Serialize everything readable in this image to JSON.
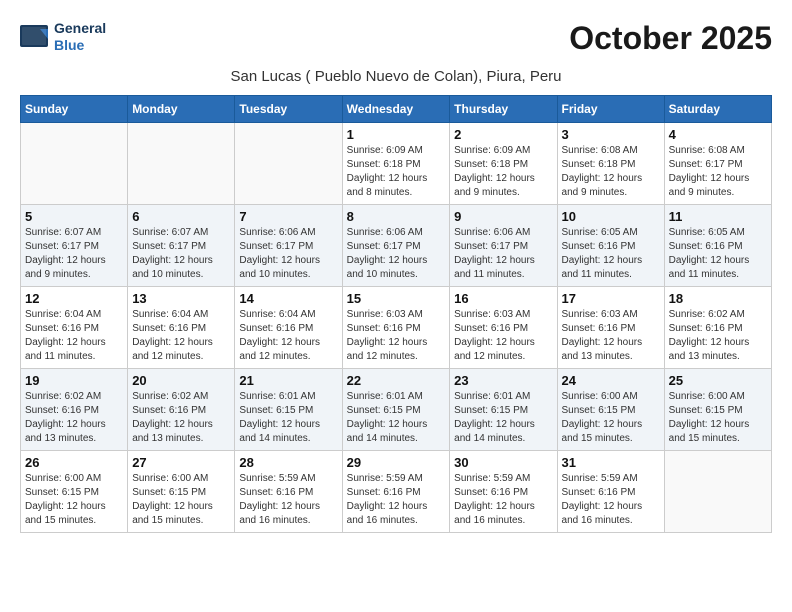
{
  "logo": {
    "line1": "General",
    "line2": "Blue"
  },
  "header": {
    "title": "October 2025",
    "subtitle": "San Lucas ( Pueblo Nuevo de Colan), Piura, Peru"
  },
  "weekdays": [
    "Sunday",
    "Monday",
    "Tuesday",
    "Wednesday",
    "Thursday",
    "Friday",
    "Saturday"
  ],
  "weeks": [
    [
      {
        "day": "",
        "info": ""
      },
      {
        "day": "",
        "info": ""
      },
      {
        "day": "",
        "info": ""
      },
      {
        "day": "1",
        "info": "Sunrise: 6:09 AM\nSunset: 6:18 PM\nDaylight: 12 hours and 8 minutes."
      },
      {
        "day": "2",
        "info": "Sunrise: 6:09 AM\nSunset: 6:18 PM\nDaylight: 12 hours and 9 minutes."
      },
      {
        "day": "3",
        "info": "Sunrise: 6:08 AM\nSunset: 6:18 PM\nDaylight: 12 hours and 9 minutes."
      },
      {
        "day": "4",
        "info": "Sunrise: 6:08 AM\nSunset: 6:17 PM\nDaylight: 12 hours and 9 minutes."
      }
    ],
    [
      {
        "day": "5",
        "info": "Sunrise: 6:07 AM\nSunset: 6:17 PM\nDaylight: 12 hours and 9 minutes."
      },
      {
        "day": "6",
        "info": "Sunrise: 6:07 AM\nSunset: 6:17 PM\nDaylight: 12 hours and 10 minutes."
      },
      {
        "day": "7",
        "info": "Sunrise: 6:06 AM\nSunset: 6:17 PM\nDaylight: 12 hours and 10 minutes."
      },
      {
        "day": "8",
        "info": "Sunrise: 6:06 AM\nSunset: 6:17 PM\nDaylight: 12 hours and 10 minutes."
      },
      {
        "day": "9",
        "info": "Sunrise: 6:06 AM\nSunset: 6:17 PM\nDaylight: 12 hours and 11 minutes."
      },
      {
        "day": "10",
        "info": "Sunrise: 6:05 AM\nSunset: 6:16 PM\nDaylight: 12 hours and 11 minutes."
      },
      {
        "day": "11",
        "info": "Sunrise: 6:05 AM\nSunset: 6:16 PM\nDaylight: 12 hours and 11 minutes."
      }
    ],
    [
      {
        "day": "12",
        "info": "Sunrise: 6:04 AM\nSunset: 6:16 PM\nDaylight: 12 hours and 11 minutes."
      },
      {
        "day": "13",
        "info": "Sunrise: 6:04 AM\nSunset: 6:16 PM\nDaylight: 12 hours and 12 minutes."
      },
      {
        "day": "14",
        "info": "Sunrise: 6:04 AM\nSunset: 6:16 PM\nDaylight: 12 hours and 12 minutes."
      },
      {
        "day": "15",
        "info": "Sunrise: 6:03 AM\nSunset: 6:16 PM\nDaylight: 12 hours and 12 minutes."
      },
      {
        "day": "16",
        "info": "Sunrise: 6:03 AM\nSunset: 6:16 PM\nDaylight: 12 hours and 12 minutes."
      },
      {
        "day": "17",
        "info": "Sunrise: 6:03 AM\nSunset: 6:16 PM\nDaylight: 12 hours and 13 minutes."
      },
      {
        "day": "18",
        "info": "Sunrise: 6:02 AM\nSunset: 6:16 PM\nDaylight: 12 hours and 13 minutes."
      }
    ],
    [
      {
        "day": "19",
        "info": "Sunrise: 6:02 AM\nSunset: 6:16 PM\nDaylight: 12 hours and 13 minutes."
      },
      {
        "day": "20",
        "info": "Sunrise: 6:02 AM\nSunset: 6:16 PM\nDaylight: 12 hours and 13 minutes."
      },
      {
        "day": "21",
        "info": "Sunrise: 6:01 AM\nSunset: 6:15 PM\nDaylight: 12 hours and 14 minutes."
      },
      {
        "day": "22",
        "info": "Sunrise: 6:01 AM\nSunset: 6:15 PM\nDaylight: 12 hours and 14 minutes."
      },
      {
        "day": "23",
        "info": "Sunrise: 6:01 AM\nSunset: 6:15 PM\nDaylight: 12 hours and 14 minutes."
      },
      {
        "day": "24",
        "info": "Sunrise: 6:00 AM\nSunset: 6:15 PM\nDaylight: 12 hours and 15 minutes."
      },
      {
        "day": "25",
        "info": "Sunrise: 6:00 AM\nSunset: 6:15 PM\nDaylight: 12 hours and 15 minutes."
      }
    ],
    [
      {
        "day": "26",
        "info": "Sunrise: 6:00 AM\nSunset: 6:15 PM\nDaylight: 12 hours and 15 minutes."
      },
      {
        "day": "27",
        "info": "Sunrise: 6:00 AM\nSunset: 6:15 PM\nDaylight: 12 hours and 15 minutes."
      },
      {
        "day": "28",
        "info": "Sunrise: 5:59 AM\nSunset: 6:16 PM\nDaylight: 12 hours and 16 minutes."
      },
      {
        "day": "29",
        "info": "Sunrise: 5:59 AM\nSunset: 6:16 PM\nDaylight: 12 hours and 16 minutes."
      },
      {
        "day": "30",
        "info": "Sunrise: 5:59 AM\nSunset: 6:16 PM\nDaylight: 12 hours and 16 minutes."
      },
      {
        "day": "31",
        "info": "Sunrise: 5:59 AM\nSunset: 6:16 PM\nDaylight: 12 hours and 16 minutes."
      },
      {
        "day": "",
        "info": ""
      }
    ]
  ]
}
